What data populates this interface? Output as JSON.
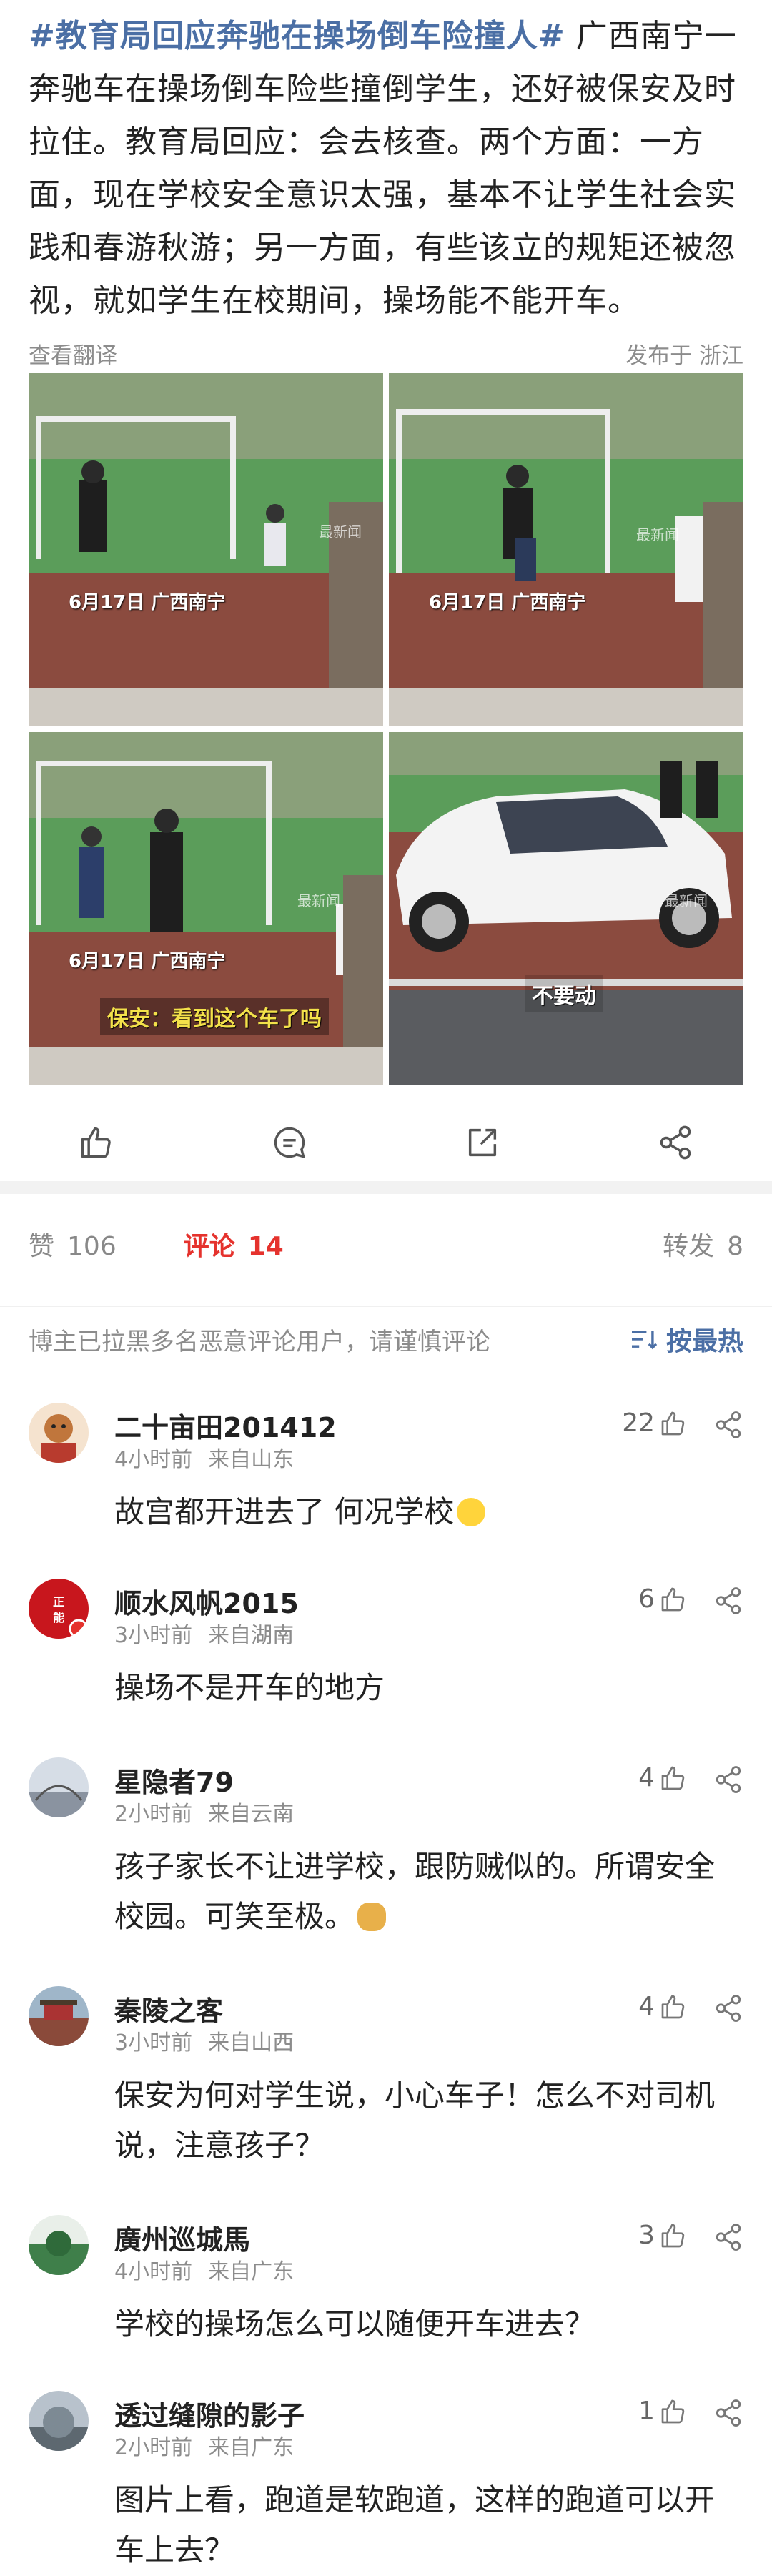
{
  "post": {
    "hashtag": "#教育局回应奔驰在操场倒车险撞人#",
    "body": " 广西南宁一奔驰车在操场倒车险些撞倒学生，还好被保安及时拉住。教育局回应：会去核查。两个方面：一方面，现在学校安全意识太强，基本不让学生社会实践和春游秋游；另一方面，有些该立的规矩还被忽视，就如学生在校期间，操场能不能开车。",
    "translate": "查看翻译",
    "published": "发布于 浙江"
  },
  "images": [
    {
      "caption": "6月17日 广西南宁",
      "watermark": "最新闻"
    },
    {
      "caption": "6月17日 广西南宁",
      "watermark": "最新闻"
    },
    {
      "caption": "6月17日 广西南宁",
      "subtitle": "保安：看到这个车了吗",
      "watermark": "最新闻"
    },
    {
      "subtitle": "不要动",
      "watermark": "最新闻"
    }
  ],
  "tabs": {
    "likes_label": "赞",
    "likes_count": "106",
    "comments_label": "评论",
    "comments_count": "14",
    "reposts_label": "转发",
    "reposts_count": "8"
  },
  "notice": "博主已拉黑多名恶意评论用户，请谨慎评论",
  "sort_label": "按最热",
  "comments": [
    {
      "name": "二十亩田201412",
      "time": "4小时前",
      "location": "来自山东",
      "likes": "22",
      "text": "故宫都开进去了 何况学校",
      "emoji": "slightly-smiling-emoji"
    },
    {
      "name": "顺水风帆2015",
      "time": "3小时前",
      "location": "来自湖南",
      "likes": "6",
      "text": "操场不是开车的地方"
    },
    {
      "name": "星隐者79",
      "time": "2小时前",
      "location": "来自云南",
      "likes": "4",
      "text": "孩子家长不让进学校，跟防贼似的。所谓安全校园。可笑至极。",
      "emoji": "doge-emoji"
    },
    {
      "name": "秦陵之客",
      "time": "3小时前",
      "location": "来自山西",
      "likes": "4",
      "text": "保安为何对学生说，小心车子！怎么不对司机说，注意孩子？"
    },
    {
      "name": "廣州巡城馬",
      "time": "4小时前",
      "location": "来自广东",
      "likes": "3",
      "text": "学校的操场怎么可以随便开车进去？"
    },
    {
      "name": "透过缝隙的影子",
      "time": "2小时前",
      "location": "来自广东",
      "likes": "1",
      "text": "图片上看，跑道是软跑道，这样的跑道可以开车上去？"
    }
  ],
  "colors": {
    "link_blue": "#4b6fa5",
    "accent_red": "#e5322d",
    "muted": "#8c8c8c"
  }
}
